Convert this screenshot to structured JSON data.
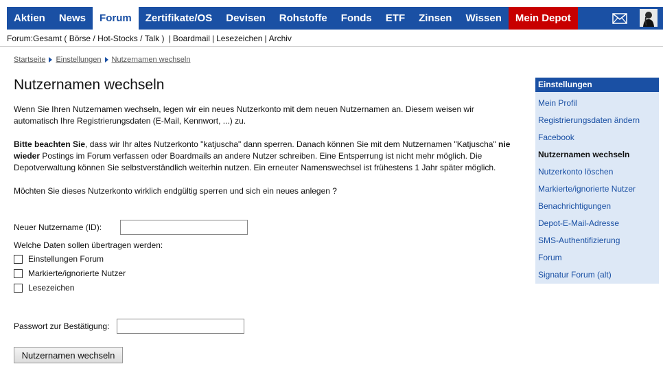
{
  "nav": {
    "items": [
      {
        "label": "Aktien",
        "state": ""
      },
      {
        "label": "News",
        "state": ""
      },
      {
        "label": "Forum",
        "state": "active"
      },
      {
        "label": "Zertifikate/OS",
        "state": ""
      },
      {
        "label": "Devisen",
        "state": ""
      },
      {
        "label": "Rohstoffe",
        "state": ""
      },
      {
        "label": "Fonds",
        "state": ""
      },
      {
        "label": "ETF",
        "state": ""
      },
      {
        "label": "Zinsen",
        "state": ""
      },
      {
        "label": "Wissen",
        "state": ""
      },
      {
        "label": "Mein Depot",
        "state": "depot"
      }
    ],
    "icons": {
      "mail": "mail-envelope-icon",
      "avatar": "user-avatar"
    },
    "colors": {
      "bar": "#1a50a4",
      "depot": "#c80000"
    }
  },
  "subnav": {
    "prefix": "Forum: ",
    "gesamt": "Gesamt",
    "open_paren": " ( ",
    "boerse": "Börse",
    "slash1": " / ",
    "hotstocks": "Hot-Stocks",
    "slash2": " / ",
    "talk": "Talk",
    "close_paren": " ) ",
    "sep1": "|",
    "boardmail": "Boardmail",
    "sep2": "|",
    "lesezeichen": "Lesezeichen",
    "sep3": "|",
    "archiv": "Archiv"
  },
  "breadcrumb": {
    "items": [
      "Startseite",
      "Einstellungen",
      "Nutzernamen wechseln"
    ]
  },
  "page": {
    "title": "Nutzernamen wechseln",
    "intro": "Wenn Sie Ihren Nutzernamen wechseln, legen wir ein neues Nutzerkonto mit dem neuen Nutzernamen an. Diesem weisen wir automatisch Ihre Registrierungsdaten (E-Mail, Kennwort, ...) zu.",
    "warn_bold1": "Bitte beachten Sie",
    "warn_text1": ", dass wir Ihr altes Nutzerkonto \"katjuscha\" dann sperren. Danach können Sie mit dem Nutzernamen \"Katjuscha\" ",
    "warn_bold2": "nie wieder",
    "warn_text2": " Postings im Forum verfassen oder Boardmails an andere Nutzer schreiben. Eine Entsperrung ist nicht mehr möglich. Die Depotverwaltung können Sie selbstverständlich weiterhin nutzen. Ein erneuter Namenswechsel ist frühestens 1 Jahr später möglich.",
    "question": "Möchten Sie dieses Nutzerkonto wirklich endgültig sperren und sich ein neues anlegen ?"
  },
  "form": {
    "new_name_label": "Neuer Nutzername (ID):",
    "new_name_value": "",
    "transfer_label": "Welche Daten sollen übertragen werden:",
    "checkboxes": [
      {
        "label": "Einstellungen Forum",
        "checked": false
      },
      {
        "label": "Markierte/ignorierte Nutzer",
        "checked": false
      },
      {
        "label": "Lesezeichen",
        "checked": false
      }
    ],
    "password_label": "Passwort zur Bestätigung:",
    "password_value": "",
    "submit_label": "Nutzernamen wechseln"
  },
  "sidebar": {
    "title": "Einstellungen",
    "items": [
      {
        "label": "Mein Profil",
        "current": false
      },
      {
        "label": "Registrierungsdaten ändern",
        "current": false
      },
      {
        "label": "Facebook",
        "current": false
      },
      {
        "label": "Nutzernamen wechseln",
        "current": true
      },
      {
        "label": "Nutzerkonto löschen",
        "current": false
      },
      {
        "label": "Markierte/ignorierte Nutzer",
        "current": false
      },
      {
        "label": "Benachrichtigungen",
        "current": false
      },
      {
        "label": "Depot-E-Mail-Adresse",
        "current": false
      },
      {
        "label": "SMS-Authentifizierung",
        "current": false
      },
      {
        "label": "Forum",
        "current": false
      },
      {
        "label": "Signatur Forum (alt)",
        "current": false
      }
    ]
  }
}
